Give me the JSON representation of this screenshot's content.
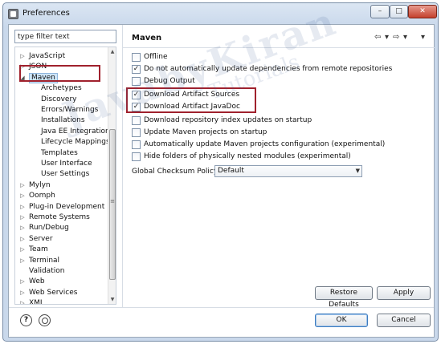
{
  "window": {
    "title": "Preferences",
    "buttons": {
      "minimize": "–",
      "maximize": "□",
      "close": "✕"
    }
  },
  "filter": {
    "placeholder": "type filter text"
  },
  "tree": {
    "items": [
      {
        "label": "JavaScript",
        "arrow": "▷",
        "level": 0
      },
      {
        "label": "JSON",
        "arrow": "▷",
        "level": 0
      },
      {
        "label": "Maven",
        "arrow": "◢",
        "level": 0,
        "selected": true
      },
      {
        "label": "Archetypes",
        "arrow": "",
        "level": 1
      },
      {
        "label": "Discovery",
        "arrow": "",
        "level": 1
      },
      {
        "label": "Errors/Warnings",
        "arrow": "",
        "level": 1
      },
      {
        "label": "Installations",
        "arrow": "",
        "level": 1
      },
      {
        "label": "Java EE Integration",
        "arrow": "",
        "level": 1
      },
      {
        "label": "Lifecycle Mappings",
        "arrow": "",
        "level": 1
      },
      {
        "label": "Templates",
        "arrow": "",
        "level": 1
      },
      {
        "label": "User Interface",
        "arrow": "",
        "level": 1
      },
      {
        "label": "User Settings",
        "arrow": "",
        "level": 1
      },
      {
        "label": "Mylyn",
        "arrow": "▷",
        "level": 0
      },
      {
        "label": "Oomph",
        "arrow": "▷",
        "level": 0
      },
      {
        "label": "Plug-in Development",
        "arrow": "▷",
        "level": 0
      },
      {
        "label": "Remote Systems",
        "arrow": "▷",
        "level": 0
      },
      {
        "label": "Run/Debug",
        "arrow": "▷",
        "level": 0
      },
      {
        "label": "Server",
        "arrow": "▷",
        "level": 0
      },
      {
        "label": "Team",
        "arrow": "▷",
        "level": 0
      },
      {
        "label": "Terminal",
        "arrow": "▷",
        "level": 0
      },
      {
        "label": "Validation",
        "arrow": "",
        "level": 0
      },
      {
        "label": "Web",
        "arrow": "▷",
        "level": 0
      },
      {
        "label": "Web Services",
        "arrow": "▷",
        "level": 0
      },
      {
        "label": "XML",
        "arrow": "▷",
        "level": 0
      }
    ],
    "scrollbar": {
      "up": "▲",
      "down": "▼",
      "grip": "≡"
    }
  },
  "page": {
    "title": "Maven",
    "nav": {
      "back": "⇦",
      "back_menu": "▾",
      "forward": "⇨",
      "forward_menu": "▾",
      "view_menu": "▾"
    },
    "options": [
      {
        "label": "Offline",
        "checked": false
      },
      {
        "label": "Do not automatically update dependencies from remote repositories",
        "checked": true
      },
      {
        "label": "Debug Output",
        "checked": false
      },
      {
        "label": "Download Artifact Sources",
        "checked": true
      },
      {
        "label": "Download Artifact JavaDoc",
        "checked": true
      },
      {
        "label": "Download repository index updates on startup",
        "checked": false
      },
      {
        "label": "Update Maven projects on startup",
        "checked": false
      },
      {
        "label": "Automatically update Maven projects configuration (experimental)",
        "checked": false
      },
      {
        "label": "Hide folders of physically nested modules (experimental)",
        "checked": false
      }
    ],
    "checksum": {
      "label": "Global Checksum Policy:",
      "value": "Default",
      "arrow": "▼"
    },
    "restore_defaults": "Restore Defaults",
    "apply": "Apply"
  },
  "footer": {
    "help_icon": "?",
    "ok": "OK",
    "cancel": "Cancel"
  },
  "watermark": {
    "main": "JavabyKiran",
    "sub": "Tutorials"
  },
  "colors": {
    "annotation": "#a0212d",
    "selection": "#cde4f7"
  }
}
